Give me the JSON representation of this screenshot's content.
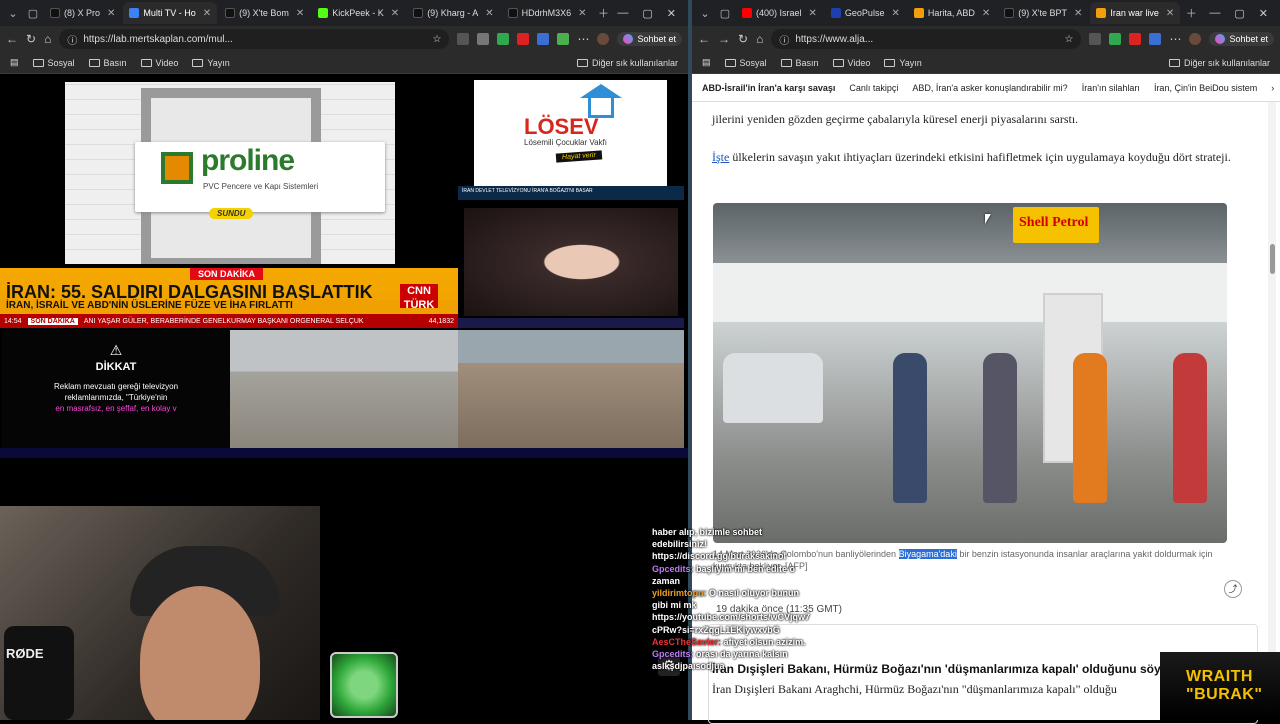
{
  "left_browser": {
    "tabs": [
      {
        "label": "(8) X Pro",
        "color": "#111111"
      },
      {
        "label": "Multi TV - Ho",
        "color": "#3b82f6",
        "active": true
      },
      {
        "label": "(9) X'te Bom",
        "color": "#111111"
      },
      {
        "label": "KickPeek - K",
        "color": "#53fc18"
      },
      {
        "label": "(9) Kharg - A",
        "color": "#111111"
      },
      {
        "label": "HDdrhM3X6",
        "color": "#111111"
      }
    ],
    "url": "https://lab.mertskaplan.com/mul...",
    "chat_button": "Sohbet et",
    "bookmarks": [
      "Sosyal",
      "Basın",
      "Video",
      "Yayın"
    ],
    "other_bookmarks": "Diğer sık kullanılanlar"
  },
  "right_browser": {
    "tabs": [
      {
        "label": "(400) Israel",
        "color": "#ff0000"
      },
      {
        "label": "GeoPulse",
        "color": "#1e40af"
      },
      {
        "label": "Harita, ABD",
        "color": "#f59e0b"
      },
      {
        "label": "(9) X'te BPT",
        "color": "#111111"
      },
      {
        "label": "Iran war live",
        "color": "#f59e0b",
        "active": true
      }
    ],
    "url": "https://www.alja...",
    "chat_button": "Sohbet et",
    "bookmarks": [
      "Sosyal",
      "Basın",
      "Video",
      "Yayın"
    ],
    "other_bookmarks": "Diğer sık kullanılanlar"
  },
  "multitv": {
    "proline": {
      "brand": "proline",
      "subtitle": "PVC Pencere ve Kapı Sistemleri",
      "sponsor": "SUNDU"
    },
    "losev": {
      "brand": "LÖSEV",
      "subtitle": "Lösemili Çocuklar Vakfı",
      "tag": "Hayat verir",
      "ticker": "İRAN DEVLET TELEVİZYONU İRAN'A BOĞAZI'NI BASAR"
    },
    "breaking": {
      "label": "SON DAKİKA",
      "headline": "İRAN: 55. SALDIRI DALGASINI BAŞLATTIK",
      "subhead": "İRAN, İSRAİL VE ABD'NİN ÜSLERİNE FÜZE VE İHA FIRLATTI",
      "channel": "CNN TÜRK",
      "time": "14:54",
      "ticker_tag": "SON DAKİKA",
      "ticker_text": "ANI YAŞAR GÜLER, BERABERİNDE GENELKURMAY BAŞKANI ORGENERAL SELÇUK",
      "index": "44,1832"
    },
    "notice": {
      "title": "DİKKAT",
      "body": "Reklam mevzuatı gereği televizyon reklamlarımızda, \"Türkiye'nin",
      "highlight": "en masrafsız, en şeffaf, en kolay v"
    }
  },
  "webcam": {
    "mic_brand": "RØDE"
  },
  "chat": [
    {
      "user": "",
      "text": "haber alıp, bizimle sohbet edebilirsiniz!"
    },
    {
      "user": "",
      "text": "https://discord.gg/buraksakinol"
    },
    {
      "user": "Gpcedits:",
      "text": "başlıyım mı ben edite o zaman",
      "user_color": "purple"
    },
    {
      "user": "yildirimtopu:",
      "text": "O nasıl oluyor bunun gibi mi mk",
      "user_color": "orange"
    },
    {
      "user": "",
      "text": "https://youtube.com/shorts/wCVjqw7cPRw?si=rxZqgL1EKIywxvbG"
    },
    {
      "user": "AesCTheSavier:",
      "text": "afiyet olsun azizim.",
      "user_color": "red"
    },
    {
      "user": "Gpcedits:",
      "text": "orası da yarına kalsın aslkşdjpaısodjua",
      "user_color": "purple"
    }
  ],
  "article": {
    "nav": [
      "ABD-İsrail'in İran'a karşı savaşı",
      "Canlı takipçi",
      "ABD, İran'a asker konuşlandırabilir mi?",
      "İran'ın silahları",
      "İran, Çin'in BeiDou sistem"
    ],
    "para1": "jilerini yeniden gözden geçirme çabalarıyla küresel enerji piyasalarını sarstı.",
    "para2_link": "İşte",
    "para2": " ülkelerin savaşın yakıt ihtiyaçları üzerindeki etkisini hafifletmek için uygulamaya koyduğu dört strateji.",
    "photo_sign": "Shell Petrol",
    "caption_pre": "14 Mart 2026'da Colombo'nun banliyölerinden ",
    "caption_hl": "Biyagama'daki",
    "caption_post": " bir benzin istasyonunda insanlar araçlarına yakıt doldurmak için kuyrukta bekliyor. [AFP]",
    "time_ago": "19 dakika önce (11:35 GMT)",
    "live_title": "İran Dışişleri Bakanı, Hürmüz Boğazı'nın 'düşmanlarımıza kapalı' olduğunu söyledi.",
    "live_body": "İran Dışişleri Bakanı Araghchi, Hürmüz Boğazı'nın \"düşmanlarımıza kapalı\" olduğu"
  },
  "overlay_badge": {
    "line1": "WRAITH",
    "line2": "\"BURAK\""
  }
}
